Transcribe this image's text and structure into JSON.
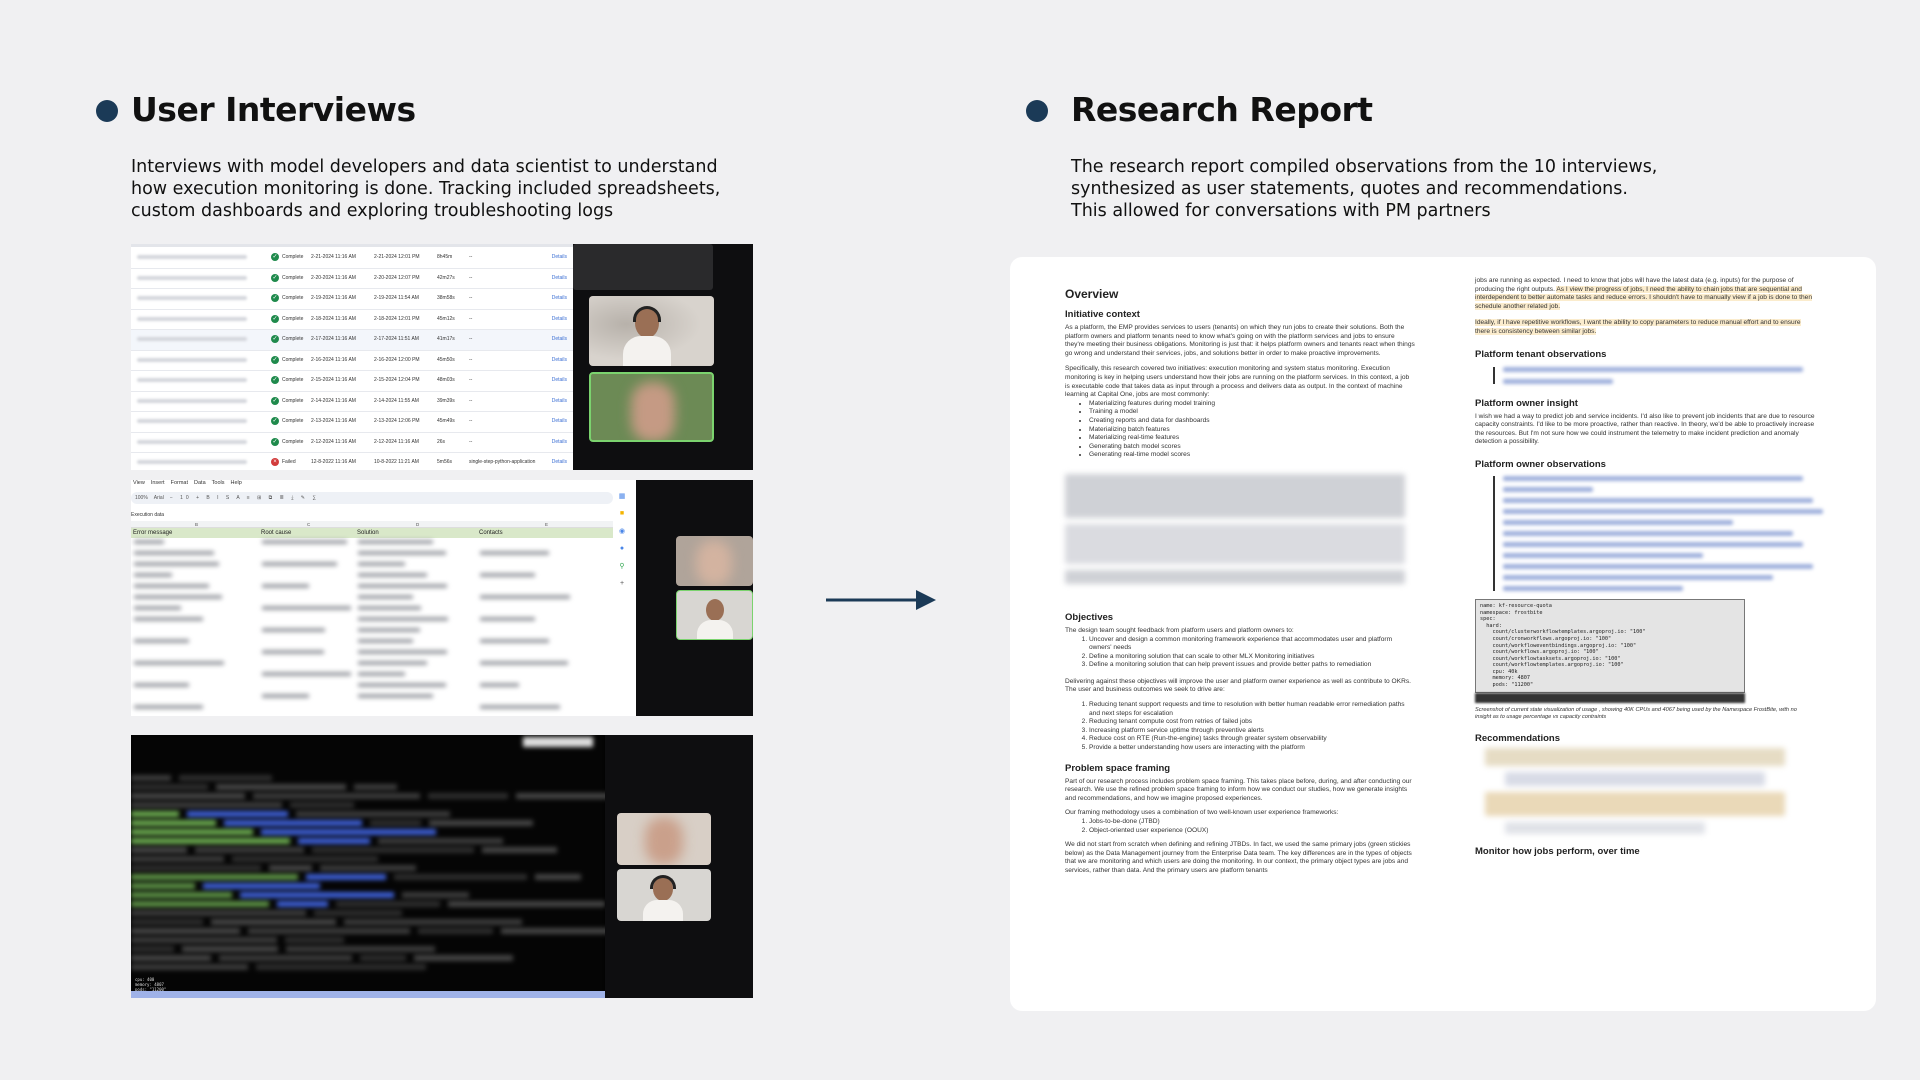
{
  "left_section": {
    "title": "User Interviews",
    "description_lines": [
      "Interviews with model developers and data scientist to understand",
      "how  execution monitoring is done. Tracking included spreadsheets,",
      "custom dashboards and exploring troubleshooting logs"
    ]
  },
  "right_section": {
    "title": "Research Report",
    "description_lines": [
      "The research report compiled observations from the 10 interviews,",
      "synthesized as user statements, quotes and recommendations.",
      "This allowed for conversations with PM partners"
    ]
  },
  "colors": {
    "bullet": "#1b3a57",
    "arrow": "#1b3a57",
    "background": "#f0f0f2"
  },
  "panel1": {
    "status_complete": "Complete",
    "status_failed": "Failed",
    "details_label": "Details",
    "rows": [
      {
        "status": "Complete",
        "start": "2-21-2024 11:16 AM",
        "end": "2-21-2024 12:01 PM",
        "dur": "8h45m"
      },
      {
        "status": "Complete",
        "start": "2-20-2024 11:16 AM",
        "end": "2-20-2024 12:07 PM",
        "dur": "42m27s"
      },
      {
        "status": "Complete",
        "start": "2-19-2024 11:16 AM",
        "end": "2-19-2024 11:54 AM",
        "dur": "38m58s"
      },
      {
        "status": "Complete",
        "start": "2-18-2024 11:16 AM",
        "end": "2-18-2024 12:01 PM",
        "dur": "45m12s"
      },
      {
        "status": "Complete",
        "start": "2-17-2024 11:16 AM",
        "end": "2-17-2024 11:51 AM",
        "dur": "41m17s"
      },
      {
        "status": "Complete",
        "start": "2-16-2024 11:16 AM",
        "end": "2-16-2024 12:00 PM",
        "dur": "45m50s"
      },
      {
        "status": "Complete",
        "start": "2-15-2024 11:16 AM",
        "end": "2-15-2024 12:04 PM",
        "dur": "48m03s"
      },
      {
        "status": "Complete",
        "start": "2-14-2024 11:16 AM",
        "end": "2-14-2024 11:55 AM",
        "dur": "39m39s"
      },
      {
        "status": "Complete",
        "start": "2-13-2024 11:16 AM",
        "end": "2-13-2024 12:06 PM",
        "dur": "45m49s"
      },
      {
        "status": "Complete",
        "start": "2-12-2024 11:16 AM",
        "end": "2-12-2024 11:16 AM",
        "dur": "26s"
      },
      {
        "status": "Failed",
        "start": "12-8-2022 11:16 AM",
        "end": "10-8-2022 11:21 AM",
        "dur": "5m56s",
        "extra": "single-step-python-application"
      }
    ]
  },
  "panel2": {
    "menu": [
      "View",
      "Insert",
      "Format",
      "Data",
      "Tools",
      "Help"
    ],
    "zoom": "100%",
    "font": "Arial",
    "sheet_label": "Execution data",
    "columns": [
      "Error message",
      "Root cause",
      "Solution",
      "Contacts"
    ],
    "col_letters": [
      "B",
      "C",
      "D",
      "E"
    ]
  },
  "panel3": {
    "code_lines": [
      "cpu: 400",
      "memory: 4807",
      "pods: \"11200\""
    ]
  },
  "report": {
    "overview": "Overview",
    "initiative_context": "Initiative context",
    "initiative_p1": "As a platform, the EMP provides services to users (tenants) on which they run jobs to create their solutions. Both the platform owners and platform tenants need to know what's going on with the platform services and jobs to ensure they're meeting their business obligations. Monitoring is just that: it helps platform owners and tenants react when things go wrong and understand their services, jobs, and solutions better in order to make proactive improvements.",
    "initiative_p2": "Specifically, this research covered two initiatives: execution monitoring and system status monitoring. Execution monitoring is key in helping users understand how their jobs are running on the platform services. In this context, a job is executable code that takes data as input through a process and delivers data as output. In the context of machine learning at Capital One, jobs are most commonly:",
    "job_types": [
      "Materializing features during model training",
      "Training a model",
      "Creating reports and data for dashboards",
      "Materializing batch features",
      "Materializing real-time features",
      "Generating batch model scores",
      "Generating real-time model scores"
    ],
    "objectives": "Objectives",
    "objectives_p": "The design team sought feedback from platform users and platform owners to:",
    "objectives_list": [
      "Uncover and design a common monitoring framework experience that accommodates user and platform owners' needs",
      "Define a monitoring solution that can scale to other MLX Monitoring initiatives",
      "Define a monitoring solution that can help prevent issues and provide better paths to remediation"
    ],
    "outcomes_p": "Delivering against these objectives will improve the user and platform owner experience as well as contribute to OKRs. The user and business outcomes we seek to drive are:",
    "outcomes_list": [
      "Reducing tenant support requests and time to resolution with better human readable error remediation paths and next steps for escalation",
      "Reducing tenant compute cost from retries of failed jobs",
      "Increasing platform service uptime through preventive alerts",
      "Reduce cost on RTE (Run-the-engine) tasks through greater system observability",
      "Provide a better understanding how users are interacting with the platform"
    ],
    "problem_space": "Problem space framing",
    "problem_p1": "Part of our research process includes problem space framing. This takes place before, during, and after conducting our research. We use the refined problem space framing to inform how we conduct our studies, how we generate insights and recommendations, and how we imagine proposed experiences.",
    "problem_p2": "Our framing methodology uses a combination of two well-known user experience frameworks:",
    "frameworks": [
      "Jobs-to-be-done (JTBD)",
      "Object-oriented user experience (OOUX)"
    ],
    "problem_p3": "We did not start from scratch when defining and refining JTBDs. In fact, we used the same primary jobs (green stickies below) as the Data Management journey from the Enterprise Data team. The key differences are in the types of objects that we are monitoring and which users are doing the monitoring. In our context, the primary object types are jobs and services, rather than data. And the primary users are platform tenants",
    "r_p1_a": "jobs are running as expected. I need to know that jobs will have the latest data (e.g. inputs) for the purpose of producing the right outputs.",
    "r_p1_b": "As I view the progress of jobs, I need the ability to chain jobs that are sequential and interdependent to better automate tasks and reduce errors. I shouldn't have to manually view if a job is done to then schedule another related job.",
    "r_p2": "Ideally, if I have repetitive workflows, I want the ability to copy parameters to reduce manual effort and to ensure there is consistency between similar jobs.",
    "tenant_obs": "Platform tenant observations",
    "owner_insight": "Platform owner insight",
    "owner_insight_p": "I wish we had a way to predict job and service incidents. I'd also like to prevent job incidents that are due to resource capacity constraints. I'd like to be more proactive, rather than reactive. In theory, we'd be able to proactively increase the resources. But I'm not sure how we could instrument the telemetry to make incident prediction and anomaly detection a possibility.",
    "owner_obs": "Platform owner observations",
    "code": "name: kf-resource-quota\nnamespace: frostbite\nspec:\n  hard:\n    count/clusterworkflowtemplates.argoproj.io: \"100\"\n    count/cronworkflows.argoproj.io: \"100\"\n    count/workfloweventbindings.argoproj.io: \"100\"\n    count/workflows.argoproj.io: \"100\"\n    count/workflowtasksets.argoproj.io: \"100\"\n    count/workflowtemplates.argoproj.io: \"100\"\n    cpu: 40k\n    memory: 4807\n    pods: \"11200\"",
    "caption": "Screenshot of current state visualization of usage , showing 40K CPUs and 4067 being used by the Namespace FrostBite, with no insight as to usage percentage vs capacity contraints",
    "recommendations": "Recommendations",
    "monitor_heading": "Monitor how jobs perform, over time"
  }
}
